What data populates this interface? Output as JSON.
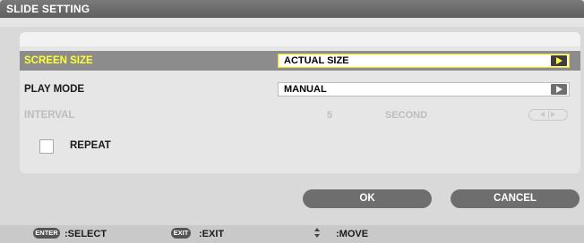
{
  "window": {
    "title": "SLIDE SETTING"
  },
  "settings": {
    "screen_size": {
      "label": "SCREEN SIZE",
      "value": "ACTUAL SIZE"
    },
    "play_mode": {
      "label": "PLAY MODE",
      "value": "MANUAL"
    },
    "interval": {
      "label": "INTERVAL",
      "value": "5",
      "unit": "SECOND"
    },
    "repeat": {
      "label": "REPEAT",
      "checked": false
    }
  },
  "buttons": {
    "ok": "OK",
    "cancel": "CANCEL"
  },
  "footer": {
    "enter_key": "ENTER",
    "select": ":SELECT",
    "exit_key": "EXIT",
    "exit": ":EXIT",
    "move": ":MOVE"
  },
  "colors": {
    "highlight_text": "#ffff33",
    "selected_row": "#8c8c8c",
    "button": "#6e6e6e"
  }
}
